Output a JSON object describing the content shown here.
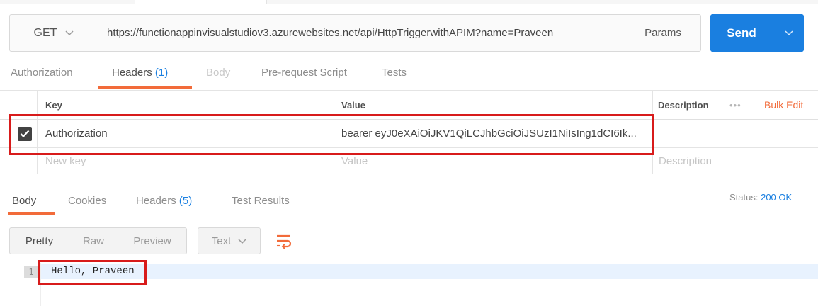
{
  "request": {
    "method": "GET",
    "url": "https://functionappinvisualstudiov3.azurewebsites.net/api/HttpTriggerwithAPIM?name=Praveen",
    "params_label": "Params",
    "send_label": "Send"
  },
  "request_tabs": {
    "authorization": "Authorization",
    "headers": "Headers",
    "headers_count": "(1)",
    "body": "Body",
    "prerequest": "Pre-request Script",
    "tests": "Tests"
  },
  "headers_table": {
    "col_key": "Key",
    "col_value": "Value",
    "col_description": "Description",
    "more": "•••",
    "bulk_edit": "Bulk Edit",
    "rows": [
      {
        "checked": true,
        "key": "Authorization",
        "value": "bearer eyJ0eXAiOiJKV1QiLCJhbGciOiJSUzI1NiIsIng1dCI6Ik..."
      }
    ],
    "new_row": {
      "key_placeholder": "New key",
      "value_placeholder": "Value",
      "description_placeholder": "Description"
    }
  },
  "response_tabs": {
    "body": "Body",
    "cookies": "Cookies",
    "headers": "Headers",
    "headers_count": "(5)",
    "test_results": "Test Results"
  },
  "status": {
    "label": "Status:",
    "value": "200 OK"
  },
  "view_controls": {
    "pretty": "Pretty",
    "raw": "Raw",
    "preview": "Preview",
    "format": "Text"
  },
  "editor": {
    "line_number": "1",
    "line_text": "Hello, Praveen"
  },
  "colors": {
    "accent_blue": "#1a7fe0",
    "accent_orange": "#f26b3a",
    "highlight_red": "#d81b1b"
  }
}
